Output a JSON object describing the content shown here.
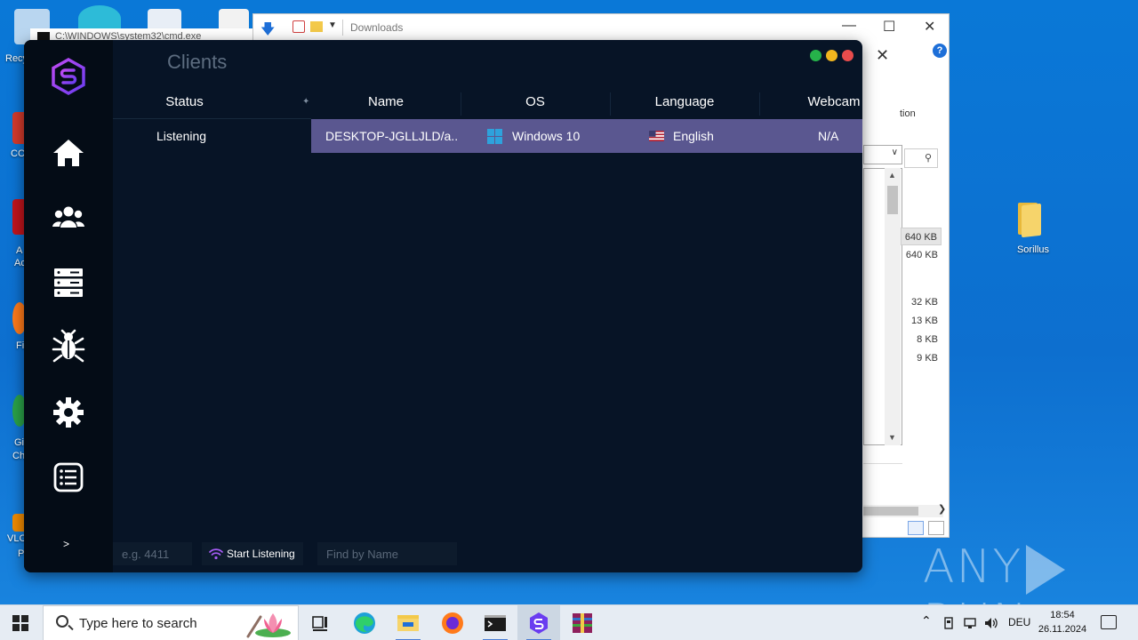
{
  "desktop": {
    "left_labels": [
      "Recy",
      "CC",
      "A",
      "Ac",
      "Fi",
      "Gi",
      "Ch",
      "VLC",
      "P"
    ],
    "folder_label": "Sorillus",
    "watermark": "ANY RUN"
  },
  "cmd_window": {
    "title": "C:\\WINDOWS\\system32\\cmd.exe"
  },
  "explorer": {
    "title": "Downloads",
    "ribbon_fragment": "tion",
    "help": "?",
    "sizes": [
      "640 KB",
      "640 KB",
      "32 KB",
      "13 KB",
      "8 KB",
      "9 KB"
    ]
  },
  "app": {
    "title": "Clients",
    "columns": {
      "status": "Status",
      "name": "Name",
      "os": "OS",
      "language": "Language",
      "webcam": "Webcam"
    },
    "status_text": "Listening",
    "client": {
      "name": "DESKTOP-JGLLJLD/a...",
      "os": "Windows 10",
      "language": "English",
      "webcam": "N/A"
    },
    "sidebar": [
      "home-icon",
      "users-icon",
      "server-icon",
      "bug-icon",
      "settings-icon",
      "list-icon"
    ],
    "expand_label": ">",
    "port_placeholder": "e.g. 4411",
    "listen_button": "Start Listening",
    "find_placeholder": "Find by Name",
    "colors": {
      "background": "#071426",
      "sidebar": "#040c16",
      "selected_row": "#5a5790",
      "accent": "#9b59f5",
      "dot_green": "#26b24a",
      "dot_yellow": "#f0b51e",
      "dot_red": "#e84c4c"
    }
  },
  "taskbar": {
    "search_placeholder": "Type here to search",
    "language": "DEU",
    "time": "18:54",
    "date": "26.11.2024"
  }
}
